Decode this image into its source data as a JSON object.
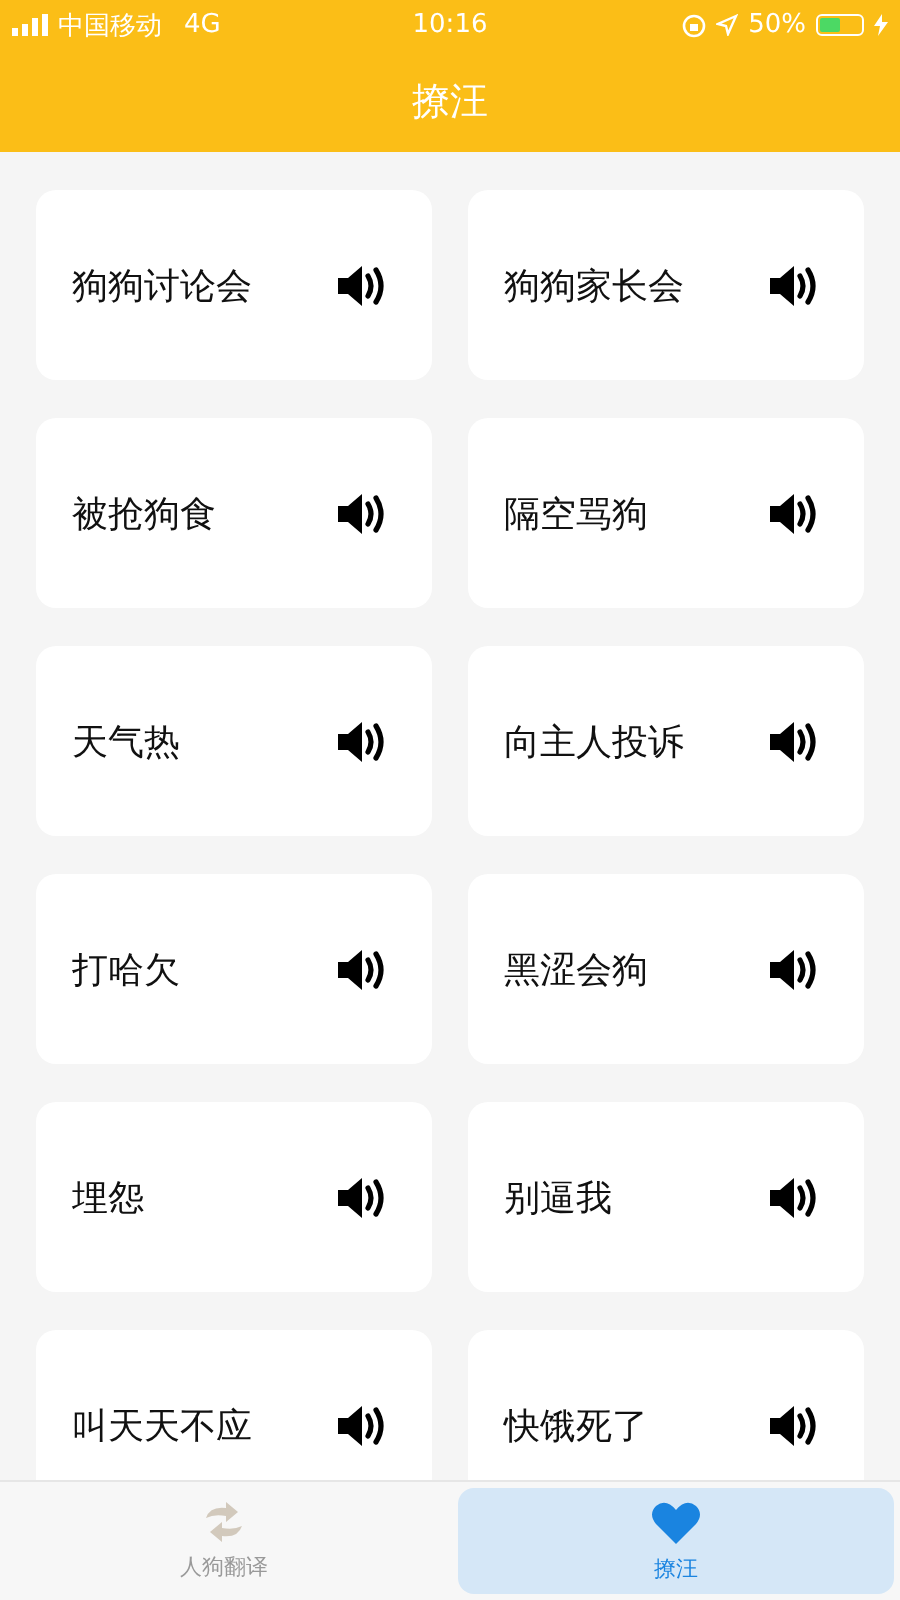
{
  "status_bar": {
    "carrier": "中国移动",
    "network": "4G",
    "time": "10:16",
    "battery": "50%"
  },
  "header": {
    "title": "撩汪"
  },
  "cards": [
    {
      "label": "狗狗讨论会"
    },
    {
      "label": "狗狗家长会"
    },
    {
      "label": "被抢狗食"
    },
    {
      "label": "隔空骂狗"
    },
    {
      "label": "天气热"
    },
    {
      "label": "向主人投诉"
    },
    {
      "label": "打哈欠"
    },
    {
      "label": "黑涩会狗"
    },
    {
      "label": "埋怨"
    },
    {
      "label": "别逼我"
    },
    {
      "label": "叫天天不应"
    },
    {
      "label": "快饿死了"
    }
  ],
  "tab_bar": [
    {
      "label": "人狗翻译",
      "kind": "translate",
      "selected": false
    },
    {
      "label": "撩汪",
      "kind": "heart",
      "selected": true
    }
  ]
}
